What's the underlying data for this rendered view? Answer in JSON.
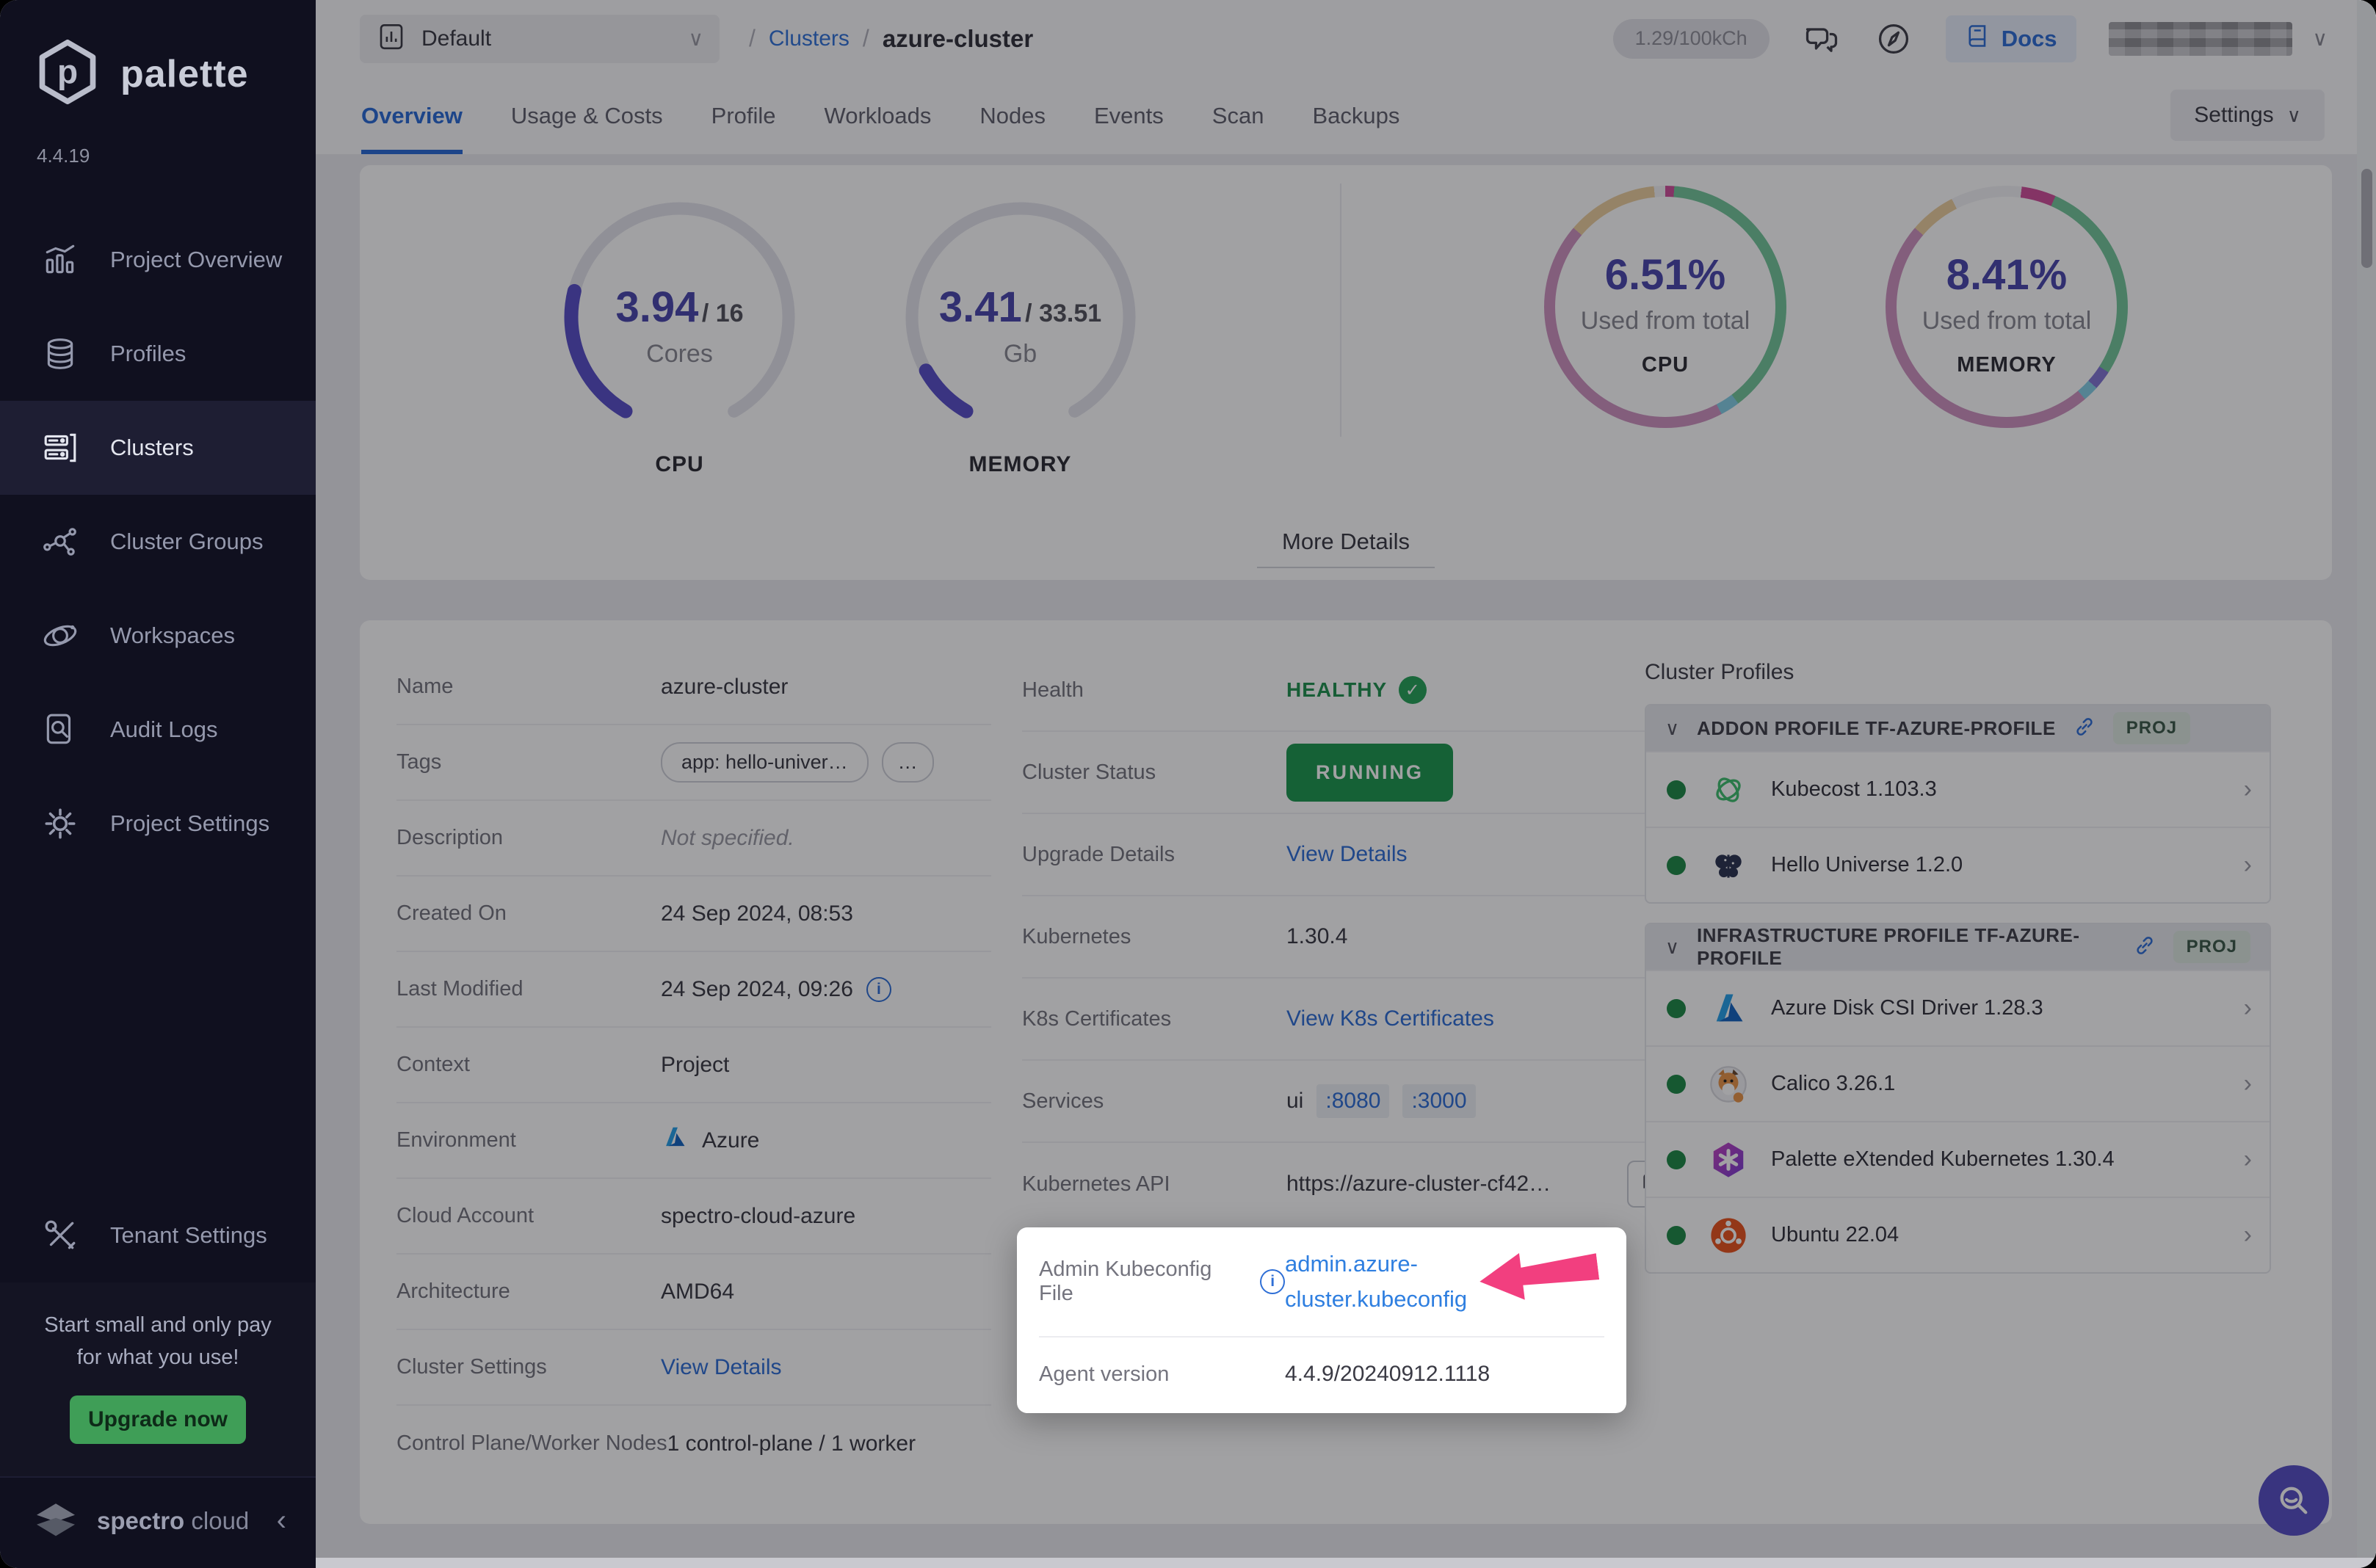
{
  "sidebar": {
    "brand": "palette",
    "version": "4.4.19",
    "items": [
      {
        "label": "Project Overview",
        "icon": "chart",
        "active": false
      },
      {
        "label": "Profiles",
        "icon": "layers",
        "active": false
      },
      {
        "label": "Clusters",
        "icon": "servers",
        "active": true
      },
      {
        "label": "Cluster Groups",
        "icon": "network",
        "active": false
      },
      {
        "label": "Workspaces",
        "icon": "orbit",
        "active": false
      },
      {
        "label": "Audit Logs",
        "icon": "audit",
        "active": false
      },
      {
        "label": "Project Settings",
        "icon": "gear",
        "active": false
      }
    ],
    "tenant_settings": {
      "label": "Tenant Settings",
      "icon": "tools"
    },
    "promo": {
      "line1": "Start small and only pay",
      "line2": "for what you use!",
      "button": "Upgrade now"
    },
    "footer": {
      "brand_bold": "spectro",
      "brand_light": "cloud",
      "collapse_icon": "‹"
    }
  },
  "topbar": {
    "project_selector": {
      "label": "Default"
    },
    "breadcrumb": {
      "sep": "/",
      "parent": "Clusters",
      "current": "azure-cluster"
    },
    "credits": "1.29/100kCh",
    "docs_label": "Docs"
  },
  "tabs": {
    "items": [
      "Overview",
      "Usage & Costs",
      "Profile",
      "Workloads",
      "Nodes",
      "Events",
      "Scan",
      "Backups"
    ],
    "active_index": 0,
    "settings_label": "Settings"
  },
  "overview_card": {
    "more_details_label": "More Details"
  },
  "chart_data": [
    {
      "type": "gauge",
      "metric": "CPU",
      "value": 3.94,
      "total": 16,
      "value_label": "3.94",
      "total_label": "/ 16",
      "unit": "Cores",
      "caption": "CPU",
      "fill_color": "#5a50c8",
      "track_color": "#e4e4ec",
      "arc_degrees": 300
    },
    {
      "type": "gauge",
      "metric": "MEMORY",
      "value": 3.41,
      "total": 33.51,
      "value_label": "3.41",
      "total_label": "/ 33.51",
      "unit": "Gb",
      "caption": "MEMORY",
      "fill_color": "#5a50c8",
      "track_color": "#e4e4ec",
      "arc_degrees": 300
    },
    {
      "type": "donut",
      "metric": "CPU",
      "percent": 6.51,
      "percent_label": "6.51%",
      "caption": "Used from total",
      "sub_caption": "CPU",
      "segments": [
        {
          "name": "magenta",
          "color": "#d14f9b",
          "pct": 1.2
        },
        {
          "name": "green",
          "color": "#74c79b",
          "pct": 38.5
        },
        {
          "name": "cyan",
          "color": "#85cfe6",
          "pct": 2.6
        },
        {
          "name": "mauve",
          "color": "#cf93c1",
          "pct": 44.0
        },
        {
          "name": "tan",
          "color": "#eccf9f",
          "pct": 12.2
        },
        {
          "name": "gap",
          "color": "#f2f2f5",
          "pct": 1.5
        }
      ]
    },
    {
      "type": "donut",
      "metric": "MEMORY",
      "percent": 8.41,
      "percent_label": "8.41%",
      "caption": "Used from total",
      "sub_caption": "MEMORY",
      "segments": [
        {
          "name": "gap",
          "color": "#f2f2f5",
          "pct": 2.0
        },
        {
          "name": "magenta",
          "color": "#d14f9b",
          "pct": 4.6
        },
        {
          "name": "green",
          "color": "#74c79b",
          "pct": 27.5
        },
        {
          "name": "purple",
          "color": "#8477d4",
          "pct": 2.6
        },
        {
          "name": "cyan",
          "color": "#85cfe6",
          "pct": 2.1
        },
        {
          "name": "mauve",
          "color": "#cf93c1",
          "pct": 47.5
        },
        {
          "name": "tan",
          "color": "#eccf9f",
          "pct": 6.2
        },
        {
          "name": "gap2",
          "color": "#f2f2f5",
          "pct": 7.5
        }
      ]
    }
  ],
  "details": {
    "col1": [
      {
        "label": "Name",
        "kind": "text",
        "value": "azure-cluster"
      },
      {
        "label": "Tags",
        "kind": "tags",
        "tags": [
          "app: hello-univer…",
          "…"
        ]
      },
      {
        "label": "Description",
        "kind": "muted",
        "value": "Not specified."
      },
      {
        "label": "Created On",
        "kind": "text",
        "value": "24 Sep 2024, 08:53"
      },
      {
        "label": "Last Modified",
        "kind": "text-info",
        "value": "24 Sep 2024, 09:26"
      },
      {
        "label": "Context",
        "kind": "text",
        "value": "Project"
      },
      {
        "label": "Environment",
        "kind": "azure",
        "value": "Azure"
      },
      {
        "label": "Cloud Account",
        "kind": "text",
        "value": "spectro-cloud-azure"
      },
      {
        "label": "Architecture",
        "kind": "text",
        "value": "AMD64"
      },
      {
        "label": "Cluster Settings",
        "kind": "link",
        "value": "View Details"
      },
      {
        "label": "Control Plane/Worker Nodes",
        "kind": "text",
        "value": "1 control-plane / 1 worker"
      }
    ],
    "col2": [
      {
        "label": "Health",
        "kind": "health",
        "value": "HEALTHY"
      },
      {
        "label": "Cluster Status",
        "kind": "status",
        "value": "RUNNING"
      },
      {
        "label": "Upgrade Details",
        "kind": "link",
        "value": "View Details"
      },
      {
        "label": "Kubernetes",
        "kind": "text",
        "value": "1.30.4"
      },
      {
        "label": "K8s Certificates",
        "kind": "link",
        "value": "View K8s Certificates"
      },
      {
        "label": "Services",
        "kind": "services",
        "prefix": "ui",
        "ports": [
          ":8080",
          ":3000"
        ]
      },
      {
        "label": "Kubernetes API",
        "kind": "api",
        "value": "https://azure-cluster-cf42…"
      }
    ]
  },
  "spotlight": {
    "rows": [
      {
        "label": "Admin Kubeconfig File",
        "value_line1": "admin.azure-",
        "value_line2": "cluster.kubeconfig",
        "value": "admin.azure-cluster.kubeconfig"
      },
      {
        "label": "Agent version",
        "value": "4.4.9/20240912.1118"
      }
    ]
  },
  "cluster_profiles": {
    "title": "Cluster Profiles",
    "sections": [
      {
        "header": "ADDON PROFILE TF-AZURE-PROFILE",
        "badge": "PROJ",
        "items": [
          {
            "name": "Kubecost 1.103.3",
            "icon": "kubecost"
          },
          {
            "name": "Hello Universe 1.2.0",
            "icon": "butterfly"
          }
        ]
      },
      {
        "header": "INFRASTRUCTURE PROFILE TF-AZURE-PROFILE",
        "badge": "PROJ",
        "items": [
          {
            "name": "Azure Disk CSI Driver 1.28.3",
            "icon": "azure"
          },
          {
            "name": "Calico 3.26.1",
            "icon": "calico"
          },
          {
            "name": "Palette eXtended Kubernetes 1.30.4",
            "icon": "pxk"
          },
          {
            "name": "Ubuntu 22.04",
            "icon": "ubuntu"
          }
        ]
      }
    ]
  },
  "colors": {
    "accent_blue": "#2f6fd6",
    "status_green": "#1d9850",
    "indigo": "#4b47ad",
    "arrow_pink": "#f23f7f"
  }
}
